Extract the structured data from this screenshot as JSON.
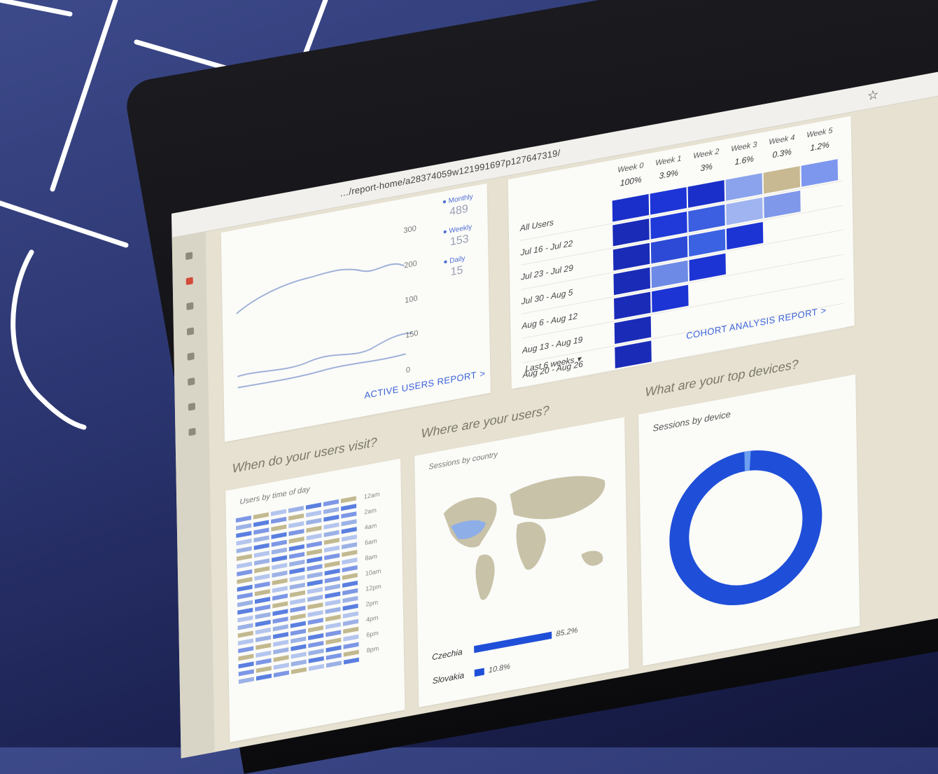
{
  "browser": {
    "url": "…/report-home/a28374059w121991697p127647319/"
  },
  "active_users": {
    "legend": [
      {
        "label": "● Monthly",
        "value": "489"
      },
      {
        "label": "● Weekly",
        "value": "153"
      },
      {
        "label": "● Daily",
        "value": "15"
      }
    ],
    "y_ticks": [
      "300",
      "200",
      "100",
      "150",
      "0"
    ],
    "link_label": "ACTIVE USERS REPORT",
    "link_chevron": ">"
  },
  "cohort": {
    "weeks": [
      "Week 0",
      "Week 1",
      "Week 2",
      "Week 3",
      "Week 4",
      "Week 5"
    ],
    "percentages": [
      "100%",
      "3.9%",
      "3%",
      "1.6%",
      "0.3%",
      "1.2%"
    ],
    "rows": [
      {
        "label": "All Users",
        "cells": [
          "#1a2fc9",
          "#1d35d6",
          "#1a2fc9",
          "#8aa3ec",
          "#c8b992",
          "#7d97ee"
        ]
      },
      {
        "label": "Jul 16 - Jul 22",
        "cells": [
          "#1a2bb8",
          "#1f3ad9",
          "#3b5fe0",
          "#9fb4f0",
          "#7f98ea"
        ]
      },
      {
        "label": "Jul 23 - Jul 29",
        "cells": [
          "#1a2bb8",
          "#2d4ad6",
          "#3b62e3",
          "#1c34d4"
        ]
      },
      {
        "label": "Jul 30 - Aug 5",
        "cells": [
          "#1a2bb8",
          "#6d8ae6",
          "#1c34d4"
        ]
      },
      {
        "label": "Aug 6 - Aug 12",
        "cells": [
          "#1a2bb8",
          "#1c34d4"
        ]
      },
      {
        "label": "Aug 13 - Aug 19",
        "cells": [
          "#1a2bb8"
        ]
      },
      {
        "label": "Aug 20 - Aug 26",
        "cells": [
          "#1a2bb8"
        ]
      }
    ],
    "period": "Last 6 weeks ▾",
    "link_label": "COHORT ANALYSIS REPORT",
    "link_chevron": ">"
  },
  "questions": {
    "when": "When do your users visit?",
    "where": "Where are your users?",
    "devices": "What are your top devices?"
  },
  "time_of_day": {
    "title": "Users by time of day",
    "hours": [
      "12am",
      "2am",
      "4am",
      "6am",
      "8am",
      "10am",
      "12pm",
      "2pm",
      "4pm",
      "6pm",
      "8pm"
    ]
  },
  "country": {
    "title": "Sessions by country",
    "bars": [
      {
        "country": "Czechia",
        "value": "85.2%",
        "fraction": 0.852
      },
      {
        "country": "Slovakia",
        "value": "10.8%",
        "fraction": 0.108
      }
    ]
  },
  "devices": {
    "title": "Sessions by device"
  },
  "colors": {
    "background": "#2b3570",
    "accent": "#1f4fd8",
    "screen_bg": "#e6e1d0"
  }
}
